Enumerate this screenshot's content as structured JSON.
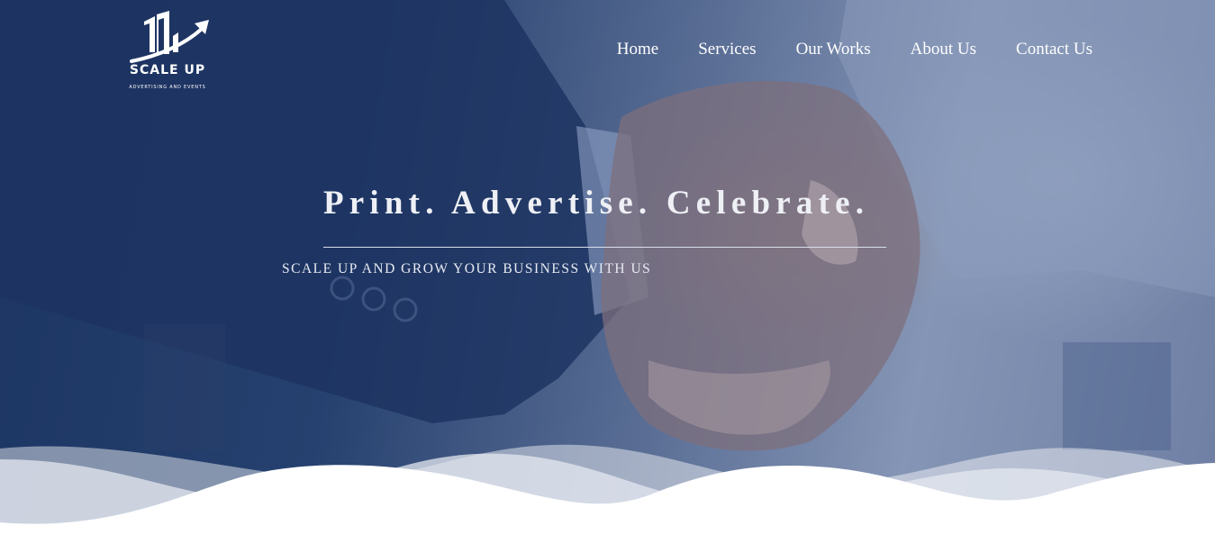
{
  "brand": {
    "name": "SCALE UP",
    "tagline": "ADVERTISING AND EVENTS"
  },
  "nav": {
    "items": [
      {
        "label": "Home"
      },
      {
        "label": "Services"
      },
      {
        "label": "Our Works"
      },
      {
        "label": "About Us"
      },
      {
        "label": "Contact Us"
      }
    ]
  },
  "hero": {
    "headline": "Print. Advertise. Celebrate.",
    "subheadline": "SCALE UP AND GROW YOUR BUSINESS WITH US",
    "background": "handshake-photo"
  },
  "colors": {
    "overlay": "#26416f",
    "text": "#ffffff",
    "wave": "#ffffff"
  }
}
